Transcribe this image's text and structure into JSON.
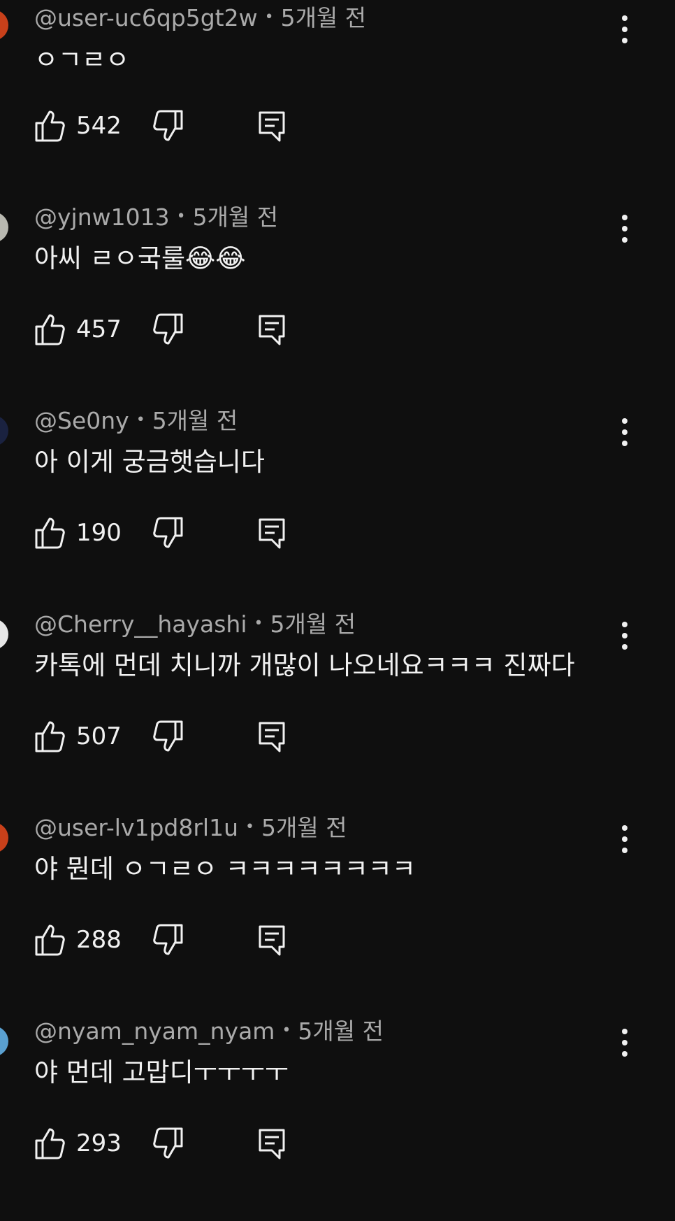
{
  "comments": [
    {
      "author": "@user-uc6qp5gt2w",
      "separator": "•",
      "time": "5개월 전",
      "text": "ㅇㄱㄹㅇ",
      "likes": "542",
      "avatar_color": "#c8401a"
    },
    {
      "author": "@yjnw1013",
      "separator": "•",
      "time": "5개월 전",
      "text": "아씨 ㄹㅇ국룰😂😂",
      "likes": "457",
      "avatar_color": "#b8b8b0"
    },
    {
      "author": "@Se0ny",
      "separator": "•",
      "time": "5개월 전",
      "text": "아 이게 궁금햇습니다",
      "likes": "190",
      "avatar_color": "#1a2240"
    },
    {
      "author": "@Cherry__hayashi",
      "separator": "•",
      "time": "5개월 전",
      "text": "카톡에 먼데 치니까 개많이 나오네요ㅋㅋㅋ 진짜다",
      "likes": "507",
      "avatar_color": "#e6e6e6"
    },
    {
      "author": "@user-lv1pd8rl1u",
      "separator": "•",
      "time": "5개월 전",
      "text": "야 뭔데 ㅇㄱㄹㅇ ㅋㅋㅋㅋㅋㅋㅋㅋ",
      "likes": "288",
      "avatar_color": "#c8401a"
    },
    {
      "author": "@nyam_nyam_nyam",
      "separator": "•",
      "time": "5개월 전",
      "text": "야 먼데 고맙디ㅜㅜㅜㅜ",
      "likes": "293",
      "avatar_color": "#5aa0d0"
    }
  ],
  "icons": {
    "like": "thumb-up-icon",
    "dislike": "thumb-down-icon",
    "reply": "comment-reply-icon",
    "more": "more-vertical-icon"
  },
  "colors": {
    "background": "#0f0f0f",
    "primary_text": "#f1f1f1",
    "secondary_text": "#aaaaaa"
  }
}
